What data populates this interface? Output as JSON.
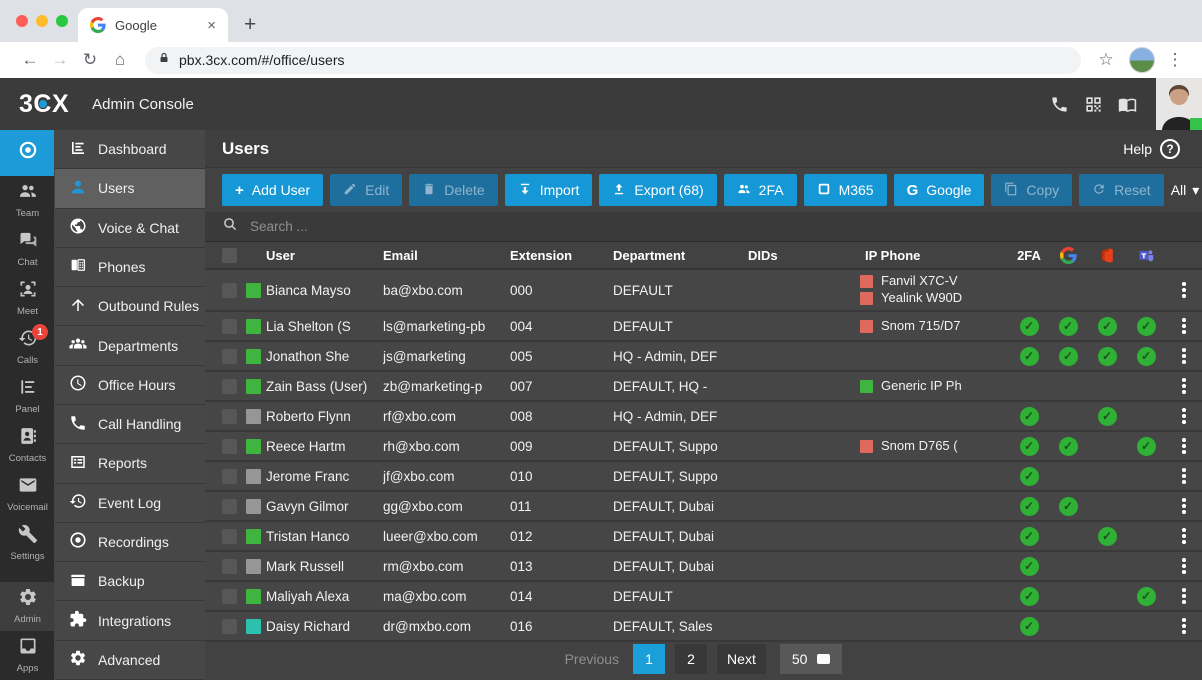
{
  "browser": {
    "tab_title": "Google",
    "tab_close": "×",
    "new_tab": "+",
    "back": "←",
    "forward": "→",
    "reload": "↻",
    "home": "⌂",
    "url": "pbx.3cx.com/#/office/users",
    "bookmark_star": "☆",
    "menu_dots": "⋮"
  },
  "header": {
    "brand": "3CX",
    "app_title": "Admin Console",
    "icons": [
      "phone-icon",
      "qr-code-icon",
      "book-icon"
    ]
  },
  "rail": {
    "items": [
      {
        "id": "logo",
        "label": "",
        "icon": "cx-logo",
        "active": true
      },
      {
        "id": "team",
        "label": "Team",
        "icon": "people"
      },
      {
        "id": "chat",
        "label": "Chat",
        "icon": "chat"
      },
      {
        "id": "meet",
        "label": "Meet",
        "icon": "meet"
      },
      {
        "id": "calls",
        "label": "Calls",
        "icon": "history",
        "badge": "1"
      },
      {
        "id": "panel",
        "label": "Panel",
        "icon": "panel"
      },
      {
        "id": "contacts",
        "label": "Contacts",
        "icon": "contacts"
      },
      {
        "id": "voicemail",
        "label": "Voicemail",
        "icon": "mail"
      },
      {
        "id": "settings",
        "label": "Settings",
        "icon": "wrench"
      },
      {
        "id": "admin",
        "label": "Admin",
        "icon": "gear",
        "highlighted": true,
        "pinned": true
      },
      {
        "id": "apps",
        "label": "Apps",
        "icon": "apps",
        "pinned": true
      }
    ]
  },
  "nav": {
    "items": [
      {
        "label": "Dashboard",
        "icon": "dashboard"
      },
      {
        "label": "Users",
        "icon": "user",
        "active": true
      },
      {
        "label": "Voice & Chat",
        "icon": "globe"
      },
      {
        "label": "Phones",
        "icon": "phones"
      },
      {
        "label": "Outbound Rules",
        "icon": "arrow-up"
      },
      {
        "label": "Departments",
        "icon": "groups"
      },
      {
        "label": "Office Hours",
        "icon": "clock"
      },
      {
        "label": "Call Handling",
        "icon": "handset"
      },
      {
        "label": "Reports",
        "icon": "reports"
      },
      {
        "label": "Event Log",
        "icon": "history"
      },
      {
        "label": "Recordings",
        "icon": "record"
      },
      {
        "label": "Backup",
        "icon": "backup"
      },
      {
        "label": "Integrations",
        "icon": "puzzle"
      },
      {
        "label": "Advanced",
        "icon": "gear"
      }
    ]
  },
  "page": {
    "title": "Users",
    "help_label": "Help",
    "help_glyph": "?",
    "search_placeholder": "Search ...",
    "filter_label": "All",
    "filter_caret": "▾"
  },
  "toolbar": {
    "buttons": [
      {
        "label": "Add User",
        "icon": "plus",
        "enabled": true
      },
      {
        "label": "Edit",
        "icon": "pencil",
        "enabled": false
      },
      {
        "label": "Delete",
        "icon": "trash",
        "enabled": false
      },
      {
        "label": "Import",
        "icon": "import",
        "enabled": true
      },
      {
        "label": "Export (68)",
        "icon": "export",
        "enabled": true
      },
      {
        "label": "2FA",
        "icon": "people",
        "enabled": true
      },
      {
        "label": "M365",
        "icon": "m365",
        "enabled": true
      },
      {
        "label": "Google",
        "icon": "g-letter",
        "enabled": true
      },
      {
        "label": "Copy",
        "icon": "copy",
        "enabled": false
      },
      {
        "label": "Reset",
        "icon": "reset",
        "enabled": false
      }
    ]
  },
  "table": {
    "columns": [
      "User",
      "Email",
      "Extension",
      "Department",
      "DIDs",
      "IP Phone",
      "2FA"
    ],
    "icon_columns": [
      "google-logo",
      "office-logo",
      "teams-logo"
    ],
    "rows": [
      {
        "name": "Bianca Mayso",
        "email": "ba@xbo.com",
        "extension": "000",
        "department": "DEFAULT",
        "dids": "",
        "status": "green",
        "phones": [
          {
            "color": "red",
            "label": "Fanvil X7C-V"
          },
          {
            "color": "red",
            "label": "Yealink W90D"
          }
        ],
        "checks": {
          "tfa": false,
          "google": false,
          "office": false,
          "teams": false
        }
      },
      {
        "name": "Lia Shelton (S",
        "email": "ls@marketing-pb",
        "extension": "004",
        "department": "DEFAULT",
        "dids": "",
        "status": "green",
        "phones": [
          {
            "color": "red",
            "label": "Snom 715/D7"
          }
        ],
        "checks": {
          "tfa": true,
          "google": true,
          "office": true,
          "teams": true
        }
      },
      {
        "name": "Jonathon She",
        "email": "js@marketing",
        "extension": "005",
        "department": "HQ - Admin, DEF",
        "dids": "",
        "status": "green",
        "phones": [],
        "checks": {
          "tfa": true,
          "google": true,
          "office": true,
          "teams": true
        }
      },
      {
        "name": "Zain Bass (User)",
        "email": "zb@marketing-p",
        "extension": "007",
        "department": "DEFAULT, HQ -",
        "dids": "",
        "status": "green",
        "phones": [
          {
            "color": "green",
            "label": "Generic IP Ph"
          }
        ],
        "checks": {
          "tfa": false,
          "google": false,
          "office": false,
          "teams": false
        }
      },
      {
        "name": "Roberto Flynn",
        "email": "rf@xbo.com",
        "extension": "008",
        "department": "HQ - Admin, DEF",
        "dids": "",
        "status": "gray",
        "phones": [],
        "checks": {
          "tfa": true,
          "google": false,
          "office": true,
          "teams": false
        }
      },
      {
        "name": "Reece Hartm",
        "email": "rh@xbo.com",
        "extension": "009",
        "department": "DEFAULT, Suppo",
        "dids": "",
        "status": "green",
        "phones": [
          {
            "color": "red",
            "label": "Snom D765 ("
          }
        ],
        "checks": {
          "tfa": true,
          "google": true,
          "office": false,
          "teams": true
        }
      },
      {
        "name": "Jerome Franc",
        "email": "jf@xbo.com",
        "extension": "010",
        "department": "DEFAULT, Suppo",
        "dids": "",
        "status": "gray",
        "phones": [],
        "checks": {
          "tfa": true,
          "google": false,
          "office": false,
          "teams": false
        }
      },
      {
        "name": "Gavyn Gilmor",
        "email": "gg@xbo.com",
        "extension": "011",
        "department": "DEFAULT, Dubai",
        "dids": "",
        "status": "gray",
        "phones": [],
        "checks": {
          "tfa": true,
          "google": true,
          "office": false,
          "teams": false
        }
      },
      {
        "name": "Tristan Hanco",
        "email": "lueer@xbo.com",
        "extension": "012",
        "department": "DEFAULT, Dubai",
        "dids": "",
        "status": "green",
        "phones": [],
        "checks": {
          "tfa": true,
          "google": false,
          "office": true,
          "teams": false
        }
      },
      {
        "name": "Mark Russell",
        "email": "rm@xbo.com",
        "extension": "013",
        "department": "DEFAULT, Dubai",
        "dids": "",
        "status": "gray",
        "phones": [],
        "checks": {
          "tfa": true,
          "google": false,
          "office": false,
          "teams": false
        }
      },
      {
        "name": "Maliyah Alexa",
        "email": "ma@xbo.com",
        "extension": "014",
        "department": "DEFAULT",
        "dids": "",
        "status": "green",
        "phones": [],
        "checks": {
          "tfa": true,
          "google": false,
          "office": false,
          "teams": true
        }
      },
      {
        "name": "Daisy Richard",
        "email": "dr@mxbo.com",
        "extension": "016",
        "department": "DEFAULT, Sales",
        "dids": "",
        "status": "teal",
        "phones": [],
        "checks": {
          "tfa": true,
          "google": false,
          "office": false,
          "teams": false
        }
      }
    ]
  },
  "pagination": {
    "previous": "Previous",
    "pages": [
      "1",
      "2"
    ],
    "active_page": "1",
    "next": "Next",
    "page_size": "50"
  },
  "colors": {
    "accent_blue": "#1798d6",
    "disabled_blue": "#1e6e9e",
    "check_green": "#2eb135",
    "presence_green": "#3fb53f",
    "presence_gray": "#969696",
    "presence_teal": "#2cc0ae",
    "phone_red": "#e0695d",
    "badge_red": "#e8443a"
  }
}
